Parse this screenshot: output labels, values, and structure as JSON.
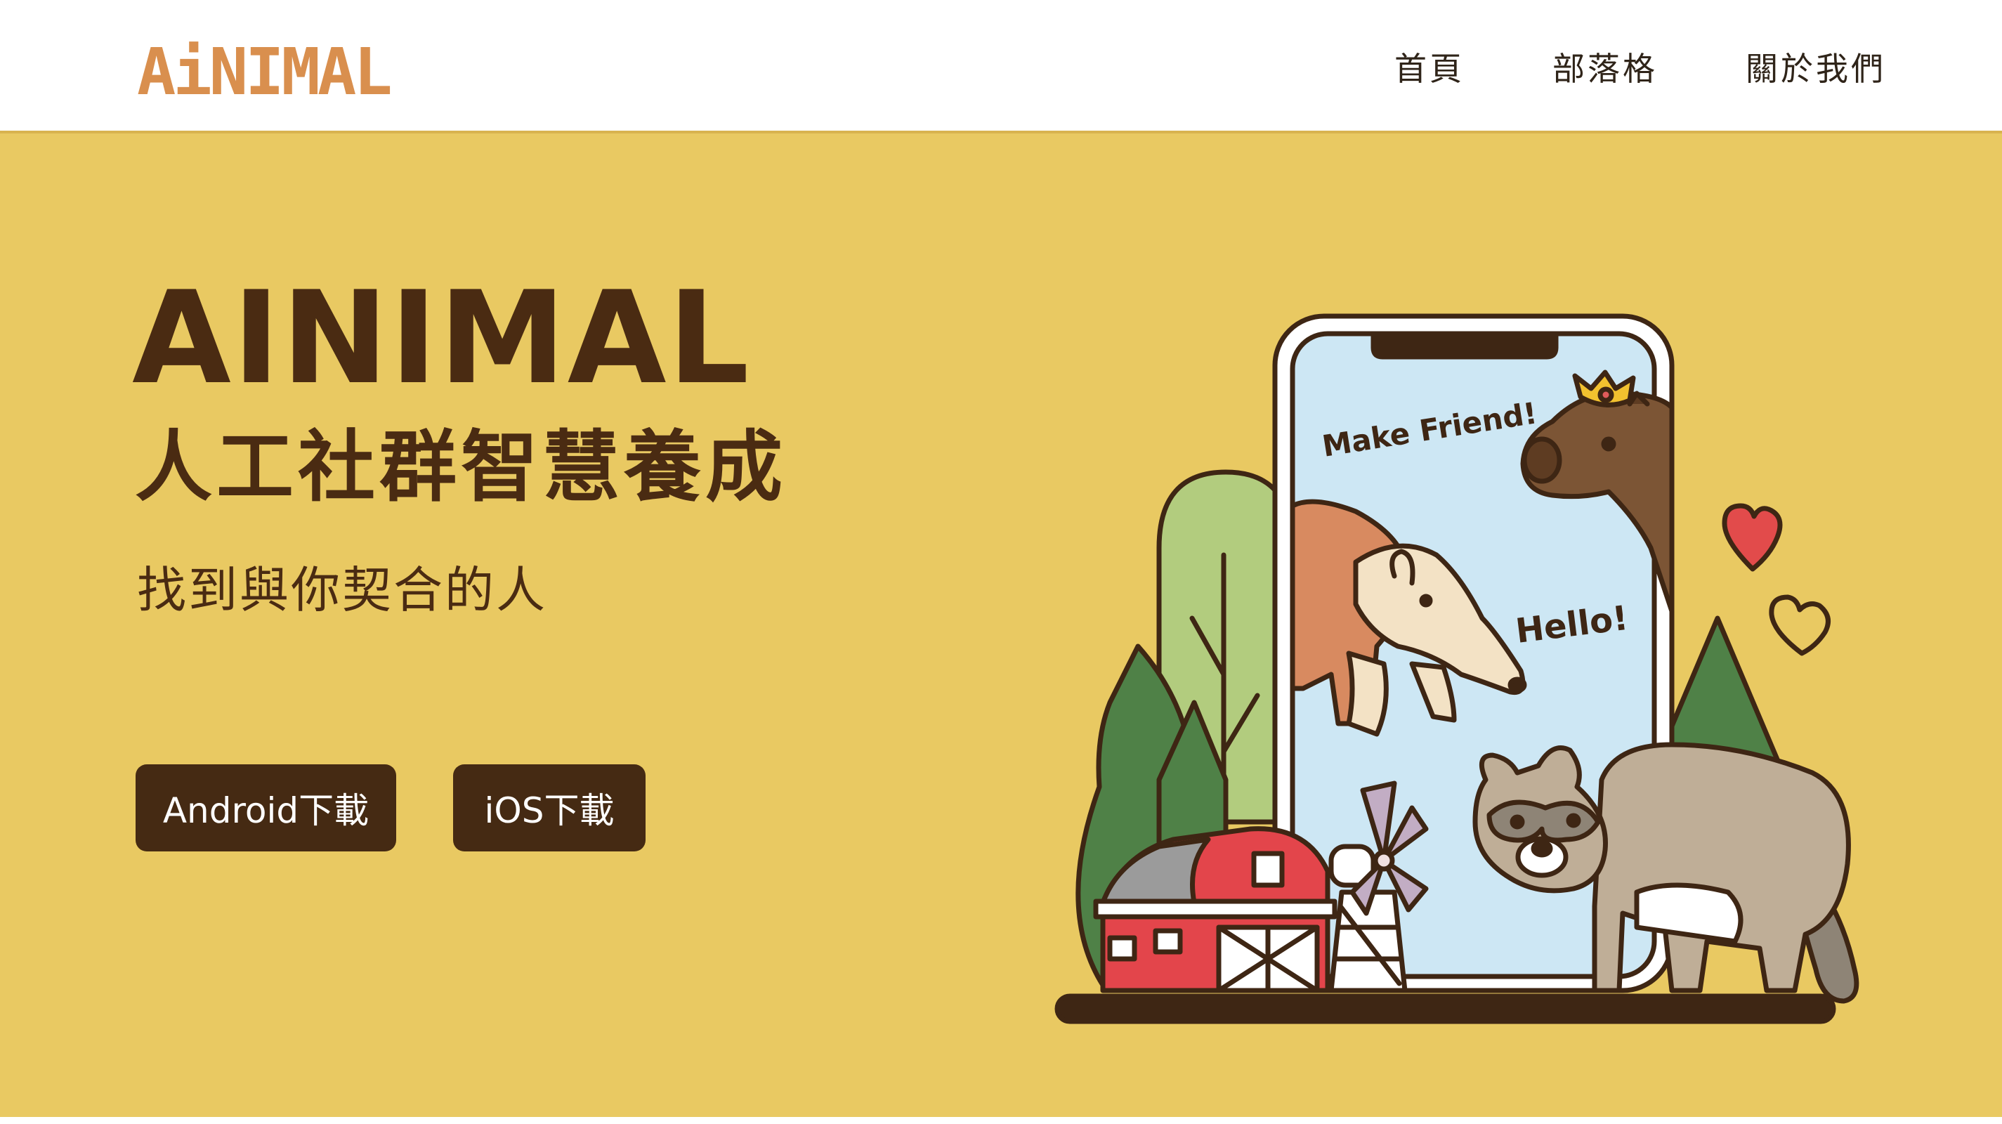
{
  "brand": {
    "logo_text": "AiNIMAL",
    "logo_color": "#d98f4e"
  },
  "nav": {
    "items": [
      {
        "label": "首頁"
      },
      {
        "label": "部落格"
      },
      {
        "label": "關於我們"
      }
    ]
  },
  "hero": {
    "title": "AINIMAL",
    "subtitle": "人工社群智慧養成",
    "tagline": "找到與你契合的人",
    "background_color": "#e9c962",
    "text_color": "#4a2b12",
    "buttons": {
      "android_label": "Android下載",
      "ios_label": "iOS下載",
      "button_color": "#452a13"
    }
  },
  "illustration": {
    "speech_1": "Make Friend!",
    "speech_2": "Hello!",
    "icons": [
      "phone-icon",
      "capybara-icon",
      "crown-icon",
      "tapir-icon",
      "raccoon-icon",
      "barn-icon",
      "windmill-icon",
      "tree-icon",
      "heart-icon"
    ]
  }
}
